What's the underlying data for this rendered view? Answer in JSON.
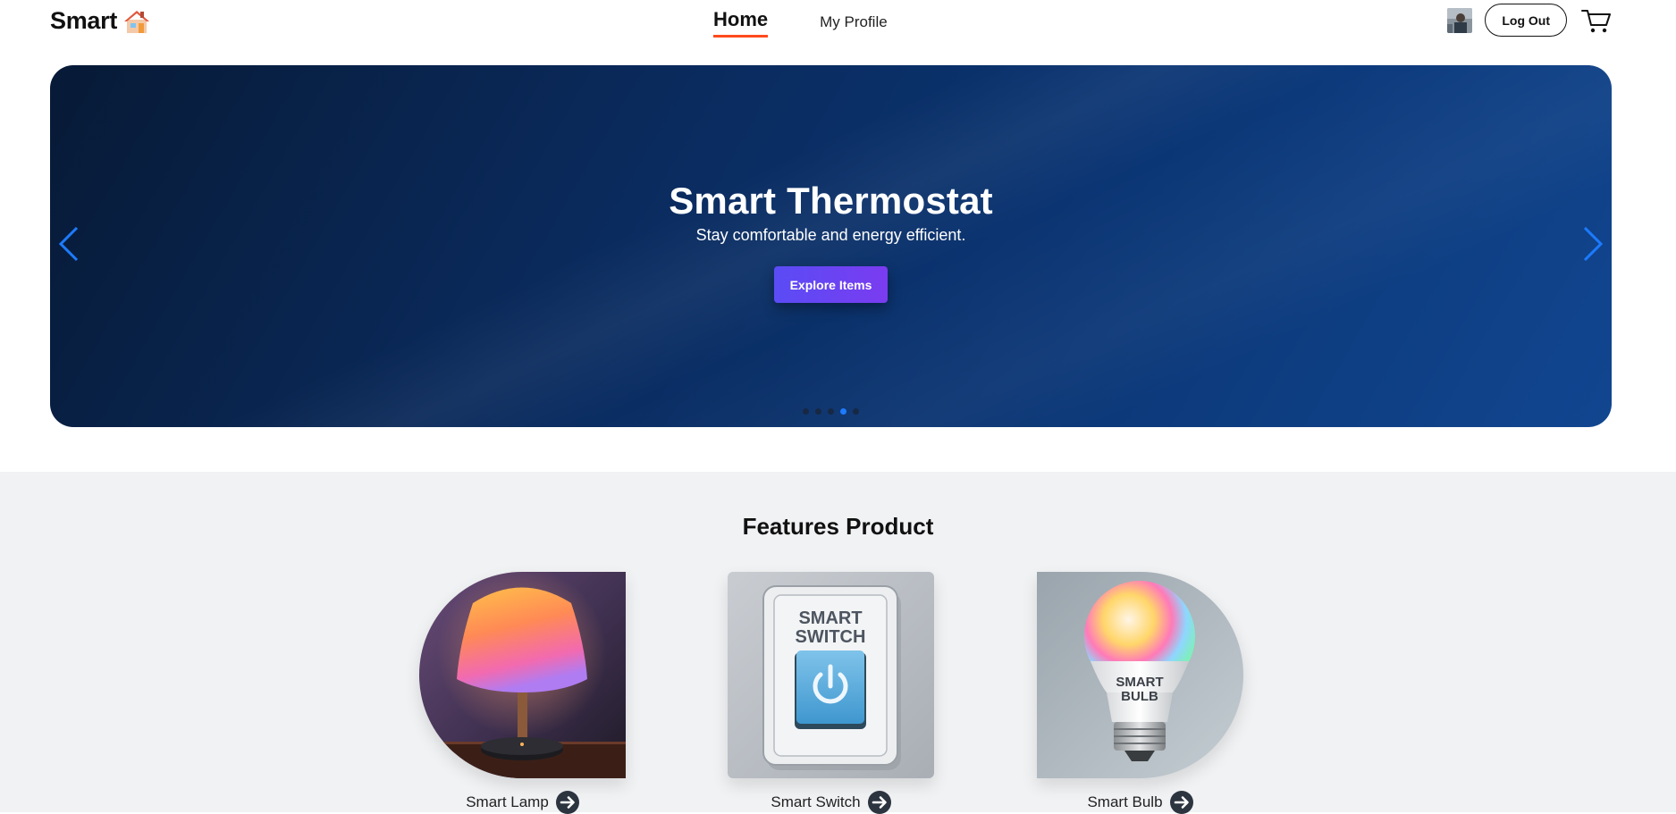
{
  "nav": {
    "logo_text": "Smart",
    "logo_icon": "house-icon",
    "links": [
      {
        "label": "Home",
        "active": true
      },
      {
        "label": "My Profile",
        "active": false
      }
    ],
    "logout_label": "Log Out",
    "cart_icon": "cart-icon"
  },
  "hero": {
    "title": "Smart Thermostat",
    "subtitle": "Stay comfortable and energy efficient.",
    "button_label": "Explore Items",
    "slide_count": 5,
    "active_slide": 4
  },
  "features": {
    "title": "Features Product",
    "products": [
      {
        "name": "Smart Lamp",
        "image_icon": "lamp-icon",
        "image_text": ""
      },
      {
        "name": "Smart Switch",
        "image_icon": "switch-icon",
        "image_text": "SMART SWITCH"
      },
      {
        "name": "Smart Bulb",
        "image_icon": "bulb-icon",
        "image_text": "SMART BULB"
      }
    ]
  },
  "colors": {
    "accent_underline": "#ff4a1c",
    "hero_arrow": "#1d7bff",
    "button_gradient_start": "#5a4cf5",
    "button_gradient_end": "#7a3cf0"
  }
}
